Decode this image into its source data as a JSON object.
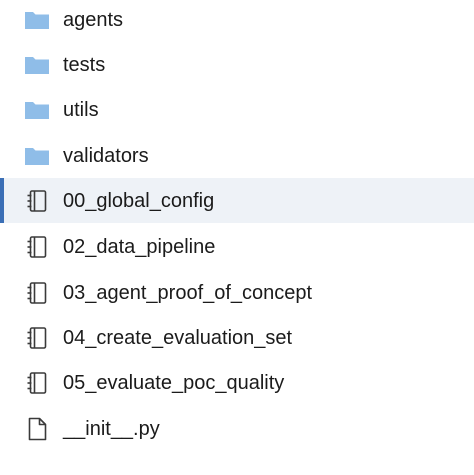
{
  "colors": {
    "folder": "#8fbde8",
    "icon_stroke": "#3a3a3a",
    "selected_bg": "#eef2f7",
    "selected_border": "#3b6fb6"
  },
  "file_list": {
    "items": [
      {
        "label": "agents",
        "icon": "folder-icon",
        "selected": false
      },
      {
        "label": "tests",
        "icon": "folder-icon",
        "selected": false
      },
      {
        "label": "utils",
        "icon": "folder-icon",
        "selected": false
      },
      {
        "label": "validators",
        "icon": "folder-icon",
        "selected": false
      },
      {
        "label": "00_global_config",
        "icon": "notebook-icon",
        "selected": true
      },
      {
        "label": "02_data_pipeline",
        "icon": "notebook-icon",
        "selected": false
      },
      {
        "label": "03_agent_proof_of_concept",
        "icon": "notebook-icon",
        "selected": false
      },
      {
        "label": "04_create_evaluation_set",
        "icon": "notebook-icon",
        "selected": false
      },
      {
        "label": "05_evaluate_poc_quality",
        "icon": "notebook-icon",
        "selected": false
      },
      {
        "label": "__init__.py",
        "icon": "file-icon",
        "selected": false
      }
    ]
  }
}
